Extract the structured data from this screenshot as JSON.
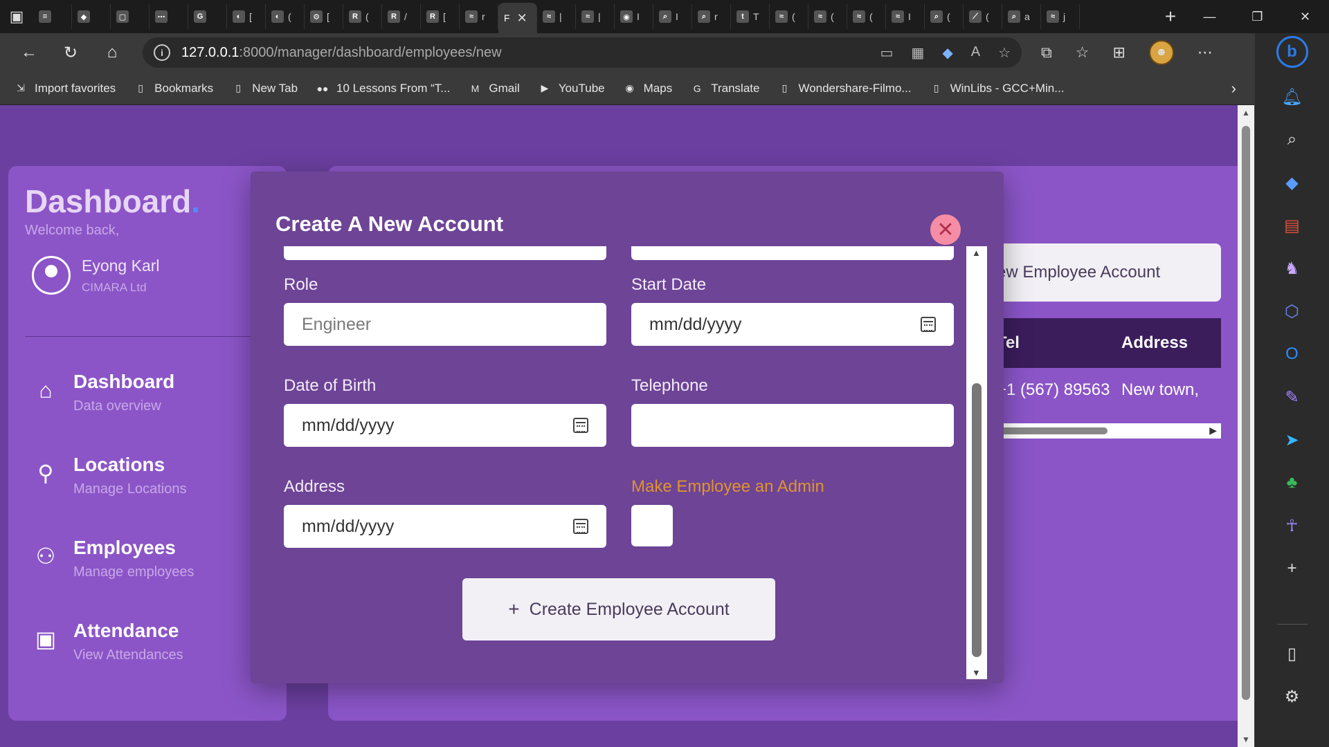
{
  "browser": {
    "tabs": [
      {
        "icon": "≡",
        "label": ""
      },
      {
        "icon": "◆",
        "label": ""
      },
      {
        "icon": "▢",
        "label": ""
      },
      {
        "icon": "⋯",
        "label": ""
      },
      {
        "icon": "G",
        "label": ""
      },
      {
        "icon": "◐",
        "label": "["
      },
      {
        "icon": "◐",
        "label": "("
      },
      {
        "icon": "⚙",
        "label": "["
      },
      {
        "icon": "R",
        "label": "("
      },
      {
        "icon": "R",
        "label": "/"
      },
      {
        "icon": "R",
        "label": "["
      },
      {
        "icon": "≈",
        "label": "r"
      },
      {
        "icon": "",
        "label": "F",
        "active": true
      },
      {
        "icon": "≈",
        "label": "|"
      },
      {
        "icon": "≈",
        "label": "|"
      },
      {
        "icon": "◉",
        "label": "I"
      },
      {
        "icon": "⌕",
        "label": "I"
      },
      {
        "icon": "⌕",
        "label": "r"
      },
      {
        "icon": "t",
        "label": "T"
      },
      {
        "icon": "≈",
        "label": "("
      },
      {
        "icon": "≈",
        "label": "("
      },
      {
        "icon": "≈",
        "label": "("
      },
      {
        "icon": "≈",
        "label": "I"
      },
      {
        "icon": "⌕",
        "label": "("
      },
      {
        "icon": "⟋",
        "label": "("
      },
      {
        "icon": "⌕",
        "label": "a"
      },
      {
        "icon": "≈",
        "label": "j"
      }
    ],
    "url_host": "127.0.0.1",
    "url_path": ":8000/manager/dashboard/employees/new",
    "bookmarks": [
      {
        "icon": "⇲",
        "label": "Import favorites"
      },
      {
        "icon": "▯",
        "label": "Bookmarks"
      },
      {
        "icon": "▯",
        "label": "New Tab"
      },
      {
        "icon": "●●",
        "label": "10 Lessons From “T..."
      },
      {
        "icon": "M",
        "label": "Gmail"
      },
      {
        "icon": "▶",
        "label": "YouTube"
      },
      {
        "icon": "◉",
        "label": "Maps"
      },
      {
        "icon": "G",
        "label": "Translate"
      },
      {
        "icon": "▯",
        "label": "Wondershare-Filmo..."
      },
      {
        "icon": "▯",
        "label": "WinLibs - GCC+Min..."
      }
    ]
  },
  "sidebar": {
    "brand": "Dashboard",
    "brand_dot": ".",
    "welcome": "Welcome back,",
    "user_name": "Eyong Karl",
    "user_company": "CIMARA Ltd",
    "nav": [
      {
        "title": "Dashboard",
        "subtitle": "Data overview",
        "icon": "home-icon"
      },
      {
        "title": "Locations",
        "subtitle": "Manage Locations",
        "icon": "location-icon"
      },
      {
        "title": "Employees",
        "subtitle": "Manage employees",
        "icon": "people-icon"
      },
      {
        "title": "Attendance",
        "subtitle": "View Attendances",
        "icon": "calendar-icon"
      }
    ]
  },
  "main": {
    "create_button": "ew Employee Account",
    "table_headers": [
      "Tel",
      "Address"
    ],
    "table_row": [
      "+1 (567) 89563",
      "New town,"
    ]
  },
  "modal": {
    "title": "Create A New Account",
    "fields": {
      "role": {
        "label": "Role",
        "placeholder": "Engineer"
      },
      "start_date": {
        "label": "Start Date",
        "value": "mm/dd/yyyy"
      },
      "dob": {
        "label": "Date of Birth",
        "value": "mm/dd/yyyy"
      },
      "telephone": {
        "label": "Telephone",
        "value": ""
      },
      "address": {
        "label": "Address",
        "value": "mm/dd/yyyy"
      },
      "admin": {
        "label": "Make Employee an Admin"
      }
    },
    "submit_label": "Create Employee Account",
    "submit_icon": "+"
  },
  "colors": {
    "page_bg": "#6b3fa0",
    "card_bg": "#8b55c7",
    "modal_bg": "#6d4496",
    "admin_label": "#e0932f",
    "close_button": "#f58ea5"
  }
}
